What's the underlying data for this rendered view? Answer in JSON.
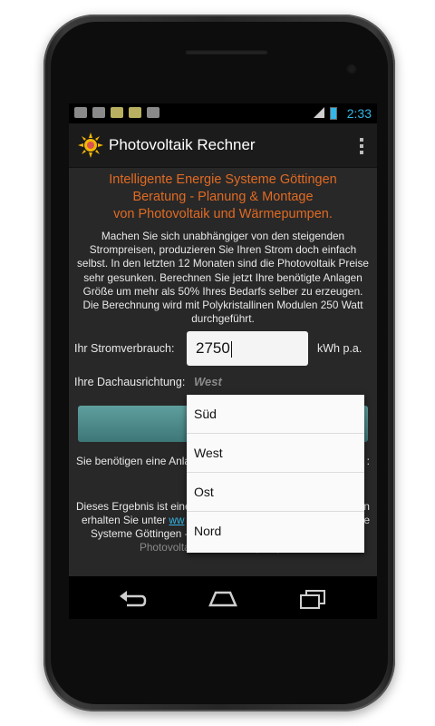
{
  "statusbar": {
    "time": "2:33",
    "icons": [
      "notification-icon",
      "image-icon",
      "notes-icon",
      "notes-icon",
      "android-icon"
    ]
  },
  "actionbar": {
    "title": "Photovoltaik Rechner",
    "app_icon": "sun-icon",
    "menu_icon": "overflow-menu-icon"
  },
  "main": {
    "headline": [
      "Intelligente Energie Systeme Göttingen",
      "Beratung - Planung & Montage",
      "von Photovoltaik und Wärmepumpen."
    ],
    "description": "Machen Sie sich unabhängiger von den steigenden Strompreisen, produzieren Sie Ihren Strom doch einfach selbst. In den letzten 12 Monaten sind die Photovoltaik Preise sehr gesunken. Berechnen Sie jetzt Ihre benötigte Anlagen Größe um mehr als 50% Ihres Bedarfs selber zu erzeugen. Die Berechnung wird mit Polykristallinen Modulen 250 Watt durchgeführt.",
    "consumption_label": "Ihr Stromverbrauch:",
    "consumption_value": "2750",
    "consumption_unit": "kWh p.a.",
    "roof_label": "Ihre Dachausrichtung:",
    "roof_value": "West",
    "result_start": "Sie benötigen eine Anla",
    "result_end": ":",
    "footer_line1_start": "Dieses Ergebnis ist eine",
    "footer_line1_end": "nen",
    "footer_line2_start": "erhalten Sie unter",
    "footer_line2_link": "ww",
    "footer_line2_end": "e",
    "footer_line3_start": "Systeme Göttingen -",
    "footer_line4": "Photovoltaik und Wärmepumpen."
  },
  "dropdown": {
    "options": [
      "Süd",
      "West",
      "Ost",
      "Nord"
    ]
  },
  "colors": {
    "accent_orange": "#e06a23",
    "link_blue": "#33b5e5",
    "button_teal": "#4f8b8b"
  }
}
